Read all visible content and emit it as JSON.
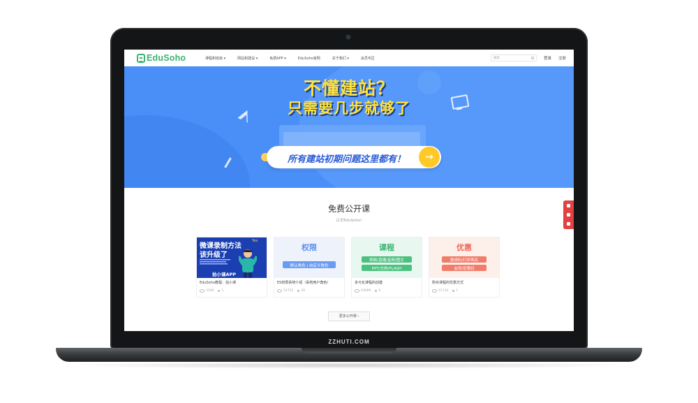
{
  "bezel_label": "ZZHUTI.COM",
  "site": {
    "logo_text": "EduSoho",
    "brand_color": "#3cb371",
    "nav": {
      "items": [
        "课程和班级 ▾",
        "网站和建设 ▾",
        "免费APP ▾",
        "EduSoho官网",
        "关于我们 ▾",
        "会员专区"
      ],
      "search_placeholder": "搜索",
      "login": "登录",
      "register": "注册"
    },
    "banner": {
      "headline_1": "不懂建站？",
      "headline_2": "只需要几步就够了",
      "cta_text": "所有建站初期问题这里都有！",
      "cta_arrow": "→",
      "bg_color": "#4a8ef7",
      "headline_color": "#ffe23d"
    },
    "section": {
      "title": "免费公开课",
      "subtitle": "认识EduSoho!",
      "more_button": "更多公开课 ›"
    },
    "courses": [
      {
        "thumb_line1": "微课录制方法",
        "thumb_line2": "该升级了",
        "thumb_extra": "Yes",
        "thumb_app": "拍小课APP",
        "title": "EduSoho教程：拍小课",
        "views": "3168",
        "students": "1"
      },
      {
        "thumb_big": "权限",
        "thumb_sub": "默认角色 | 自定义角色",
        "title": "ES权限系统介绍（系统用户角色）",
        "views": "52731",
        "students": "26"
      },
      {
        "thumb_big": "课程",
        "thumb_sub1": "视频/直播/音频/图文",
        "thumb_sub2": "PPT/文档/FLASH",
        "title": "多元化课程的创建",
        "views": "43089",
        "students": "6"
      },
      {
        "thumb_big": "优惠",
        "thumb_sub1": "邀请码/打折购买",
        "thumb_sub2": "会员/优惠码",
        "title": "购买课程的优惠方式",
        "views": "15734",
        "students": "1"
      }
    ]
  }
}
